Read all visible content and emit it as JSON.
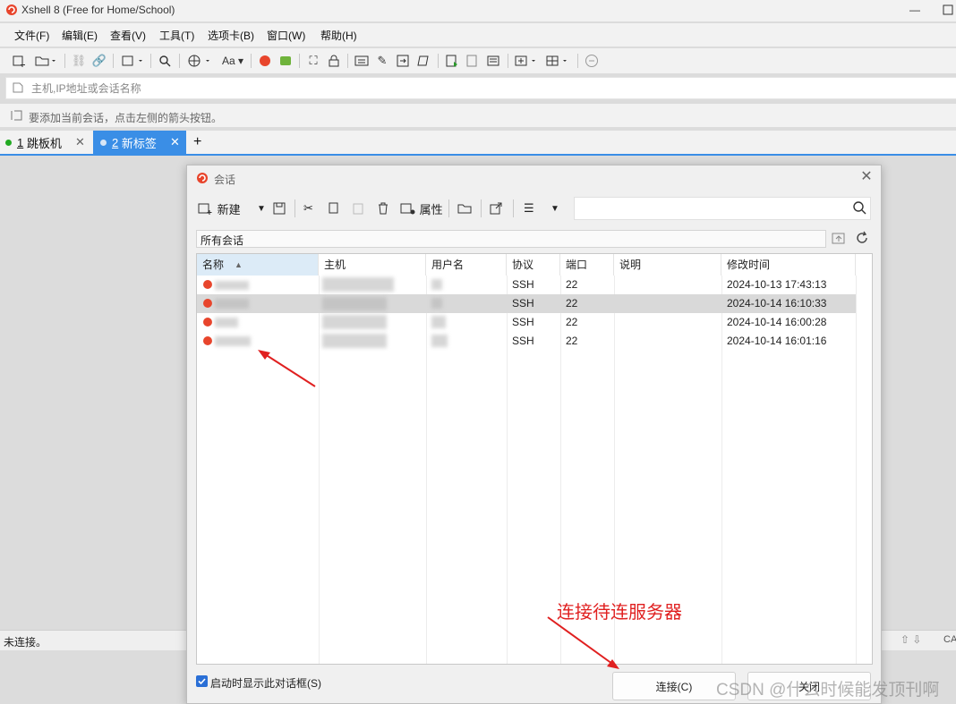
{
  "window": {
    "title": "Xshell 8 (Free for Home/School)"
  },
  "menu": [
    "文件(F)",
    "编辑(E)",
    "查看(V)",
    "工具(T)",
    "选项卡(B)",
    "窗口(W)",
    "帮助(H)"
  ],
  "toolbar": {
    "font_label": "Aa"
  },
  "address": {
    "placeholder": "主机,IP地址或会话名称"
  },
  "hint": "要添加当前会话，点击左侧的箭头按钮。",
  "tabs": [
    {
      "number": "1",
      "label": "跳板机",
      "dot_color": "#22aa22"
    },
    {
      "number": "2",
      "label": "新标签",
      "dot_color": "#d8e6f6"
    }
  ],
  "status": {
    "text": "未连接。",
    "caps": "CA"
  },
  "dialog": {
    "title": "会话",
    "toolbar": {
      "new_label": "新建",
      "properties_label": "属性"
    },
    "path": "所有会话",
    "columns": [
      "名称",
      "主机",
      "用户名",
      "协议",
      "端口",
      "说明",
      "修改时间"
    ],
    "rows": [
      {
        "protocol": "SSH",
        "port": "22",
        "modified": "2024-10-13 17:43:13",
        "selected": false
      },
      {
        "protocol": "SSH",
        "port": "22",
        "modified": "2024-10-14 16:10:33",
        "selected": true
      },
      {
        "protocol": "SSH",
        "port": "22",
        "modified": "2024-10-14 16:00:28",
        "selected": false
      },
      {
        "protocol": "SSH",
        "port": "22",
        "modified": "2024-10-14 16:01:16",
        "selected": false
      }
    ],
    "show_on_startup_label": "启动时显示此对话框(S)",
    "connect_label": "连接(C)",
    "close_label": "关闭"
  },
  "annotation": {
    "text": "连接待连服务器",
    "color": "#e02020"
  },
  "watermark": "CSDN @什么时候能发顶刊啊"
}
